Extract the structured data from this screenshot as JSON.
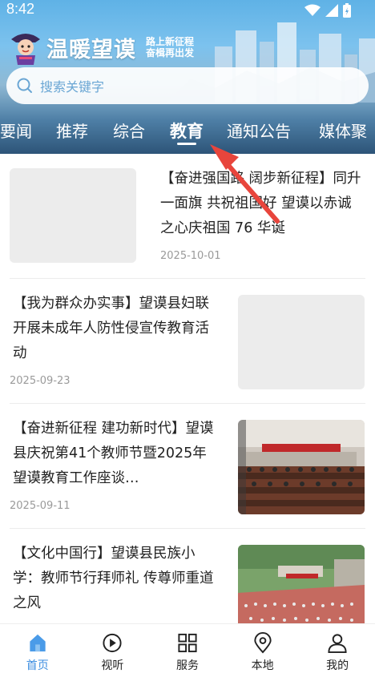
{
  "status_bar": {
    "time": "8:42"
  },
  "header": {
    "app_name": "温暖望谟",
    "slogan_line1": "路上新征程",
    "slogan_line2": "奋楫再出发"
  },
  "search": {
    "placeholder": "搜索关键字"
  },
  "tabs": [
    {
      "label": "要闻"
    },
    {
      "label": "推荐"
    },
    {
      "label": "综合"
    },
    {
      "label": "教育",
      "active": true
    },
    {
      "label": "通知公告"
    },
    {
      "label": "媒体聚"
    }
  ],
  "articles": [
    {
      "title": "【奋进强国路 阔步新征程】同升一面旗 共祝祖国好 望谟以赤诚之心庆祖国 76 华诞",
      "date": "2025-10-01"
    },
    {
      "title": "【我为群众办实事】望谟县妇联开展未成年人防性侵宣传教育活动",
      "date": "2025-09-23"
    },
    {
      "title": "【奋进新征程 建功新时代】望谟县庆祝第41个教师节暨2025年望谟教育工作座谈…",
      "date": "2025-09-11"
    },
    {
      "title": "【文化中国行】望谟县民族小学：教师节行拜师礼 传尊师重道之风",
      "date": ""
    }
  ],
  "tab_bar": [
    {
      "label": "首页",
      "icon": "home-icon",
      "active": true
    },
    {
      "label": "视听",
      "icon": "play-icon"
    },
    {
      "label": "服务",
      "icon": "grid-icon"
    },
    {
      "label": "本地",
      "icon": "location-pin-icon"
    },
    {
      "label": "我的",
      "icon": "person-icon"
    }
  ],
  "colors": {
    "accent": "#3d8ee0",
    "annotation_arrow": "#e8453c"
  }
}
